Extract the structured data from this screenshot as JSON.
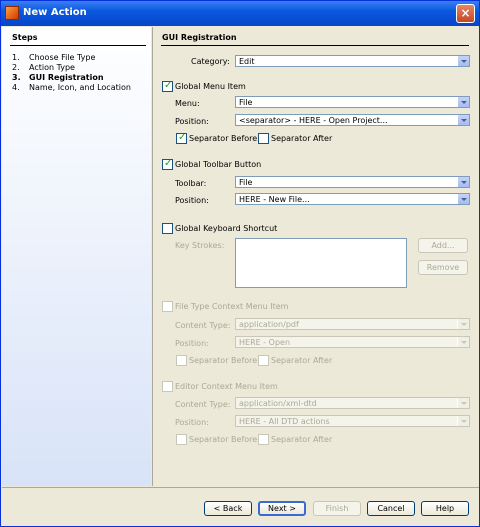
{
  "window": {
    "title": "New Action",
    "close_label": "×"
  },
  "steps": {
    "header": "Steps",
    "items": [
      {
        "num": "1.",
        "label": "Choose File Type"
      },
      {
        "num": "2.",
        "label": "Action Type"
      },
      {
        "num": "3.",
        "label": "GUI Registration"
      },
      {
        "num": "4.",
        "label": "Name, Icon, and Location"
      }
    ]
  },
  "panel": {
    "header": "GUI Registration",
    "category": {
      "label": "Category:",
      "value": "Edit"
    },
    "global_menu": {
      "label": "Global Menu Item",
      "checked": true,
      "menu_label": "Menu:",
      "menu_value": "File",
      "position_label": "Position:",
      "position_value": "<separator> - HERE - Open Project...",
      "sep_before": "Separator Before",
      "sep_after": "Separator After"
    },
    "global_toolbar": {
      "label": "Global Toolbar Button",
      "checked": true,
      "toolbar_label": "Toolbar:",
      "toolbar_value": "File",
      "position_label": "Position:",
      "position_value": "HERE - New File..."
    },
    "keyboard": {
      "label": "Global Keyboard Shortcut",
      "checked": false,
      "keystrokes_label": "Key Strokes:",
      "add": "Add...",
      "remove": "Remove"
    },
    "file_type_ctx": {
      "label": "File Type Context Menu Item",
      "content_type_label": "Content Type:",
      "content_type_value": "application/pdf",
      "position_label": "Position:",
      "position_value": "HERE - Open",
      "sep_before": "Separator Before",
      "sep_after": "Separator After"
    },
    "editor_ctx": {
      "label": "Editor Context Menu Item",
      "content_type_label": "Content Type:",
      "content_type_value": "application/xml-dtd",
      "position_label": "Position:",
      "position_value": "HERE - All DTD actions",
      "sep_before": "Separator Before",
      "sep_after": "Separator After"
    }
  },
  "buttons": {
    "back": "< Back",
    "next": "Next >",
    "finish": "Finish",
    "cancel": "Cancel",
    "help": "Help"
  }
}
